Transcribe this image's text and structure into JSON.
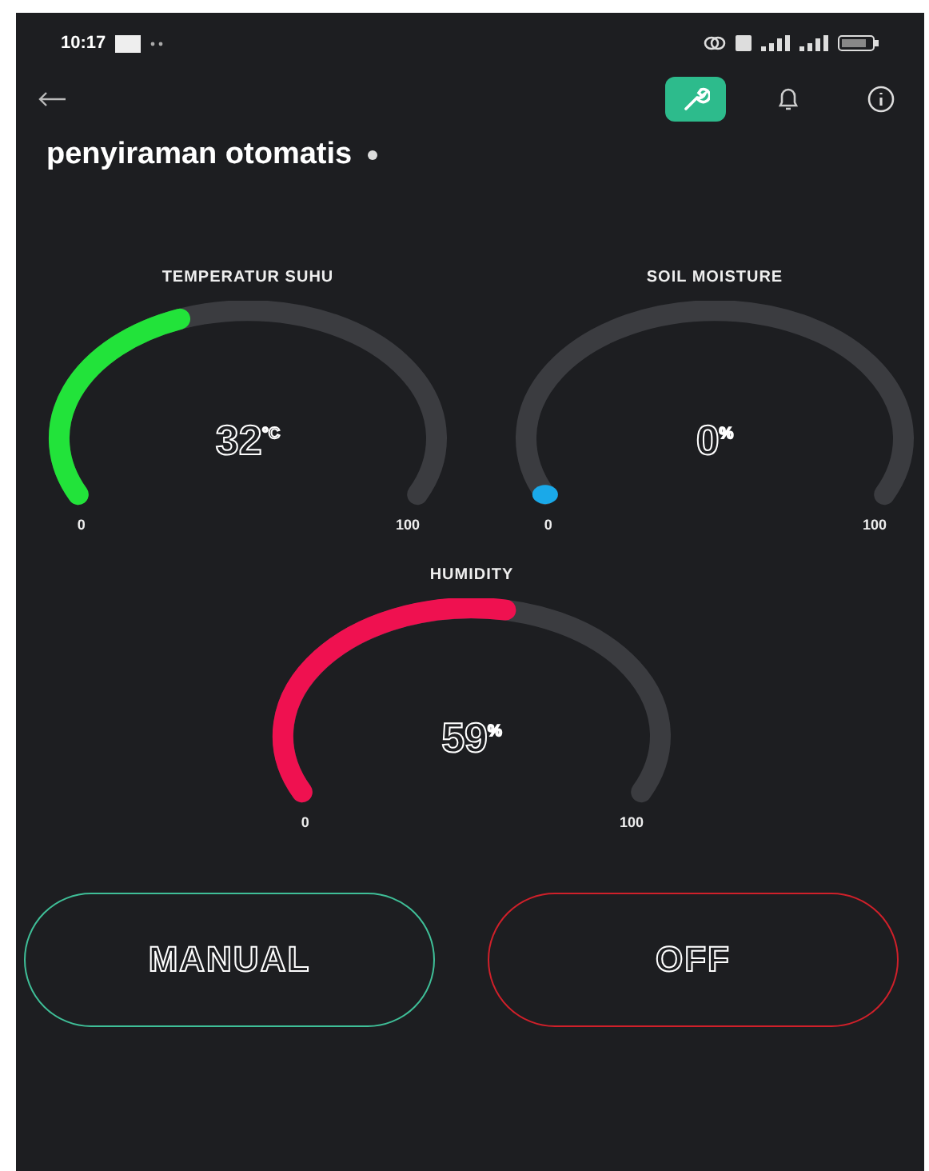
{
  "status_bar": {
    "time": "10:17"
  },
  "header": {
    "actions": [
      {
        "kind": "wrench",
        "selected": true
      },
      {
        "kind": "bell",
        "selected": false
      },
      {
        "kind": "info",
        "selected": false
      }
    ]
  },
  "title": "penyiraman otomatis",
  "gauges": [
    {
      "title": "TEMPERATUR SUHU",
      "value": "32",
      "unit": "°C",
      "level": 0.32,
      "min": "0",
      "max": "100",
      "color": "#22e33a"
    },
    {
      "title": "SOIL MOISTURE",
      "value": "0",
      "unit": "%",
      "level": 0,
      "min": "0",
      "max": "100",
      "color": "#1aa9e9"
    },
    {
      "title": "HUMIDITY",
      "value": "59",
      "unit": "%",
      "level": 0.59,
      "min": "0",
      "max": "100",
      "color": "#ef1150"
    }
  ],
  "buttons": [
    {
      "label": "MANUAL",
      "color": "#3fbf98"
    },
    {
      "label": "OFF",
      "color": "#d0202a"
    }
  ]
}
